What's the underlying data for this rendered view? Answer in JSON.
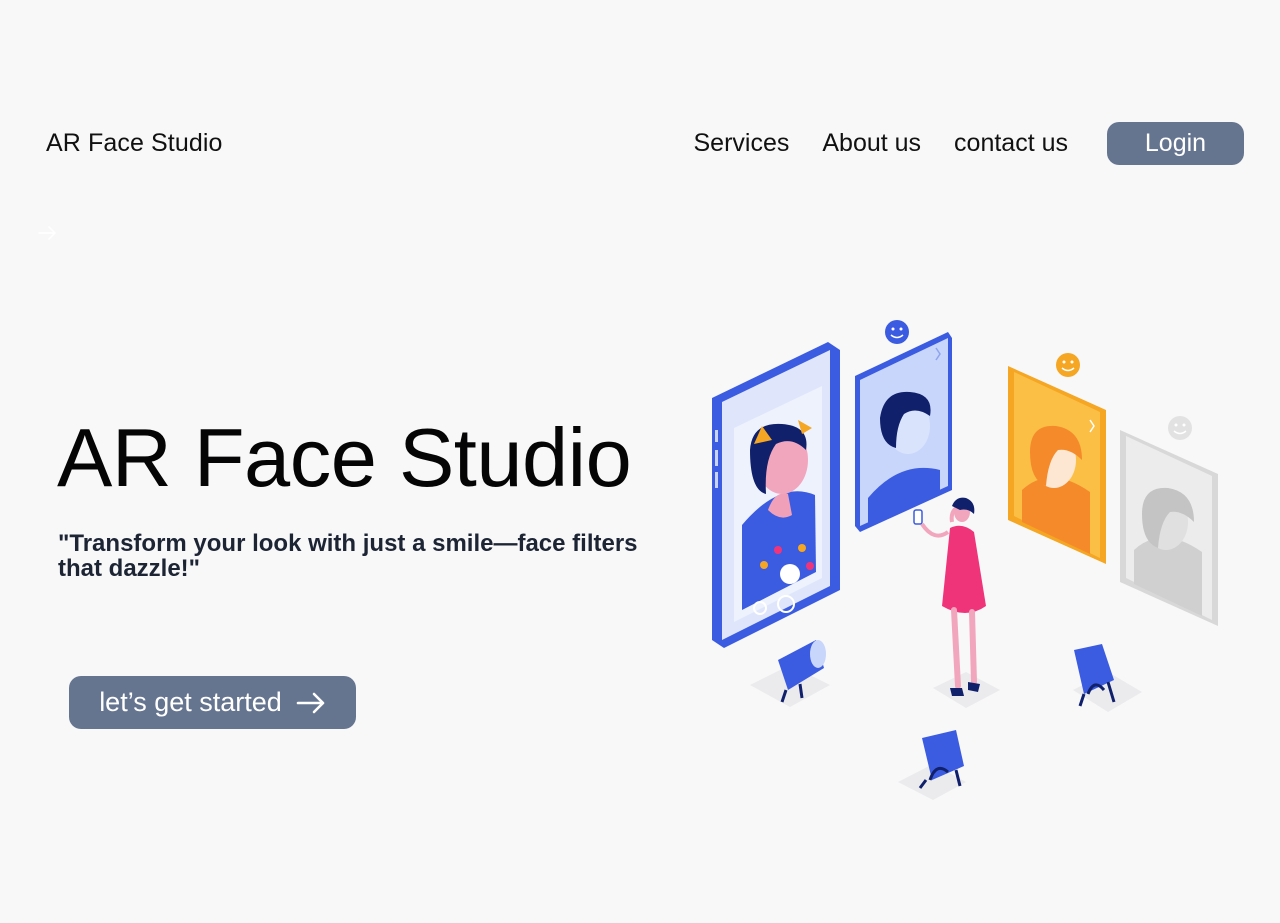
{
  "header": {
    "brand": "AR Face Studio",
    "nav": [
      "Services",
      "About us",
      "contact us"
    ],
    "login_label": "Login"
  },
  "hero": {
    "title": "AR Face Studio",
    "tagline": "\"Transform your look with just a smile—face filters that dazzle!\"",
    "cta_label": "let’s get started"
  },
  "icons": {
    "back": "arrow-right-icon",
    "cta": "arrow-right-icon"
  },
  "colors": {
    "background": "#f8f8f9",
    "button": "#66758f",
    "phone_blue": "#3b5ce0",
    "orange_card": "#f5a623",
    "figure_pink": "#f0347a"
  }
}
